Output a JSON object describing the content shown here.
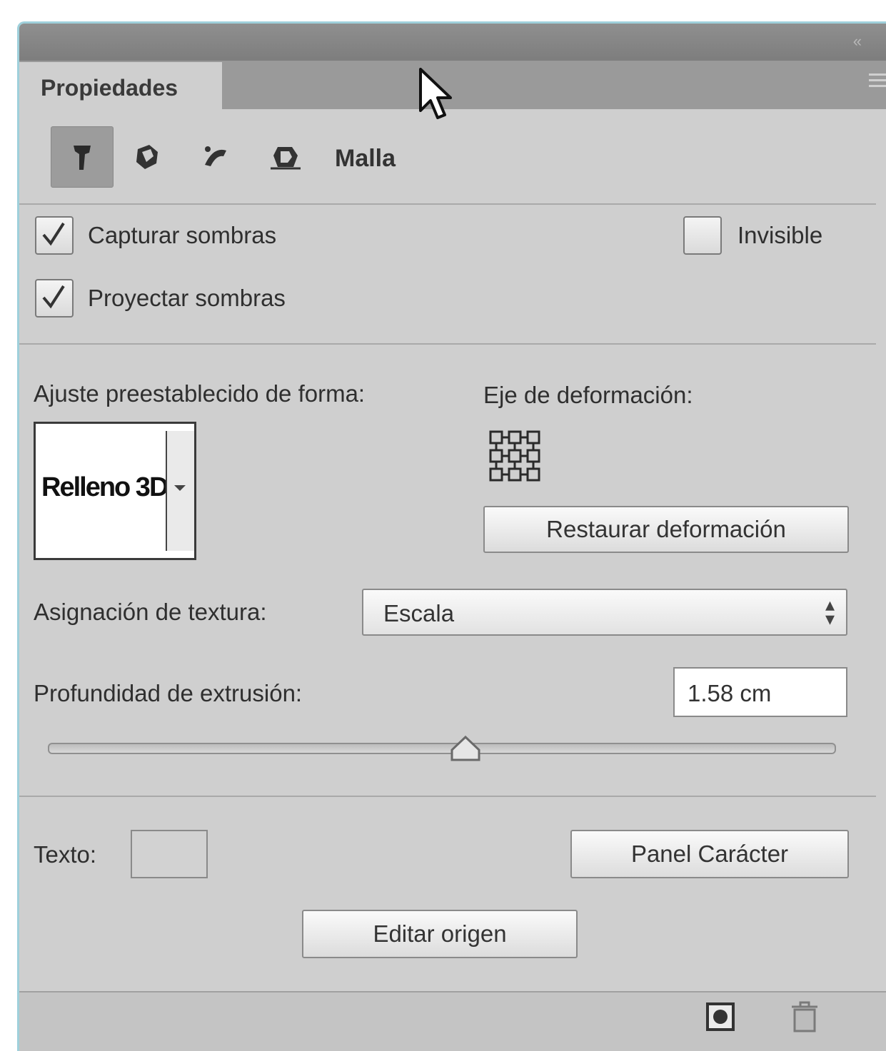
{
  "panel": {
    "tab_label": "Propiedades",
    "mode_label": "Malla",
    "mode_icons": [
      "object-icon",
      "map-icon",
      "inflate-icon",
      "deform-icon"
    ]
  },
  "options": {
    "capturar_sombras": {
      "label": "Capturar sombras",
      "checked": true
    },
    "proyectar_sombras": {
      "label": "Proyectar sombras",
      "checked": true
    },
    "invisible": {
      "label": "Invisible",
      "checked": false
    }
  },
  "shape": {
    "preset_label": "Ajuste preestablecido de forma:",
    "preset_preview_text": "Relleno 3D",
    "axis_label": "Eje de deformación:",
    "reset_button": "Restaurar deformación"
  },
  "texture": {
    "label": "Asignación de textura:",
    "value": "Escala"
  },
  "extrusion": {
    "label": "Profundidad de extrusión:",
    "value": "1.58 cm",
    "slider_fraction": 0.53
  },
  "text": {
    "label": "Texto:",
    "char_panel_button": "Panel Carácter",
    "edit_source_button": "Editar origen"
  },
  "footer": {
    "icons": [
      "render-icon",
      "trash-icon"
    ]
  }
}
